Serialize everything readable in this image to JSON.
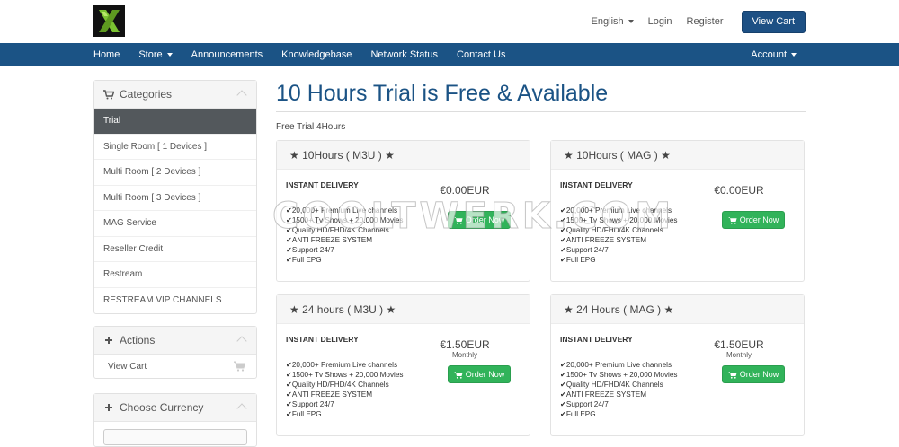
{
  "header": {
    "language_label": "English",
    "login_label": "Login",
    "register_label": "Register",
    "view_cart_label": "View Cart"
  },
  "nav": {
    "items": [
      "Home",
      "Store",
      "Announcements",
      "Knowledgebase",
      "Network Status",
      "Contact Us"
    ],
    "account_label": "Account"
  },
  "sidebar": {
    "categories_title": "Categories",
    "categories": [
      "Trial",
      "Single Room [ 1 Devices ]",
      "Multi Room [ 2 Devices ]",
      "Multi Room [ 3 Devices ]",
      "MAG Service",
      "Reseller Credit",
      "Restream",
      "RESTREAM VIP CHANNELS"
    ],
    "active_index": 0,
    "actions_title": "Actions",
    "view_cart_label": "View Cart",
    "currency_title": "Choose Currency"
  },
  "main": {
    "title": "10 Hours Trial is Free & Available",
    "subtitle": "Free Trial 4Hours",
    "watermark": "COOLTWERK.COM",
    "products": [
      {
        "name": "★ 10Hours ( M3U ) ★",
        "delivery": "INSTANT DELIVERY",
        "price": "€0.00EUR",
        "period": "",
        "order_label": "Order Now",
        "features": [
          "✔20,000+ Premium Live channels",
          "✔1500+ Tv Shows + 20,000 Movies",
          "✔Quality HD/FHD/4K Channels",
          "✔ANTI FREEZE SYSTEM",
          "✔Support 24/7",
          "✔Full EPG"
        ]
      },
      {
        "name": "★ 10Hours ( MAG ) ★",
        "delivery": "INSTANT DELIVERY",
        "price": "€0.00EUR",
        "period": "",
        "order_label": "Order Now",
        "features": [
          "✔20,000+ Premium Live channels",
          "✔1500+ Tv Shows + 20,000 Movies",
          "✔Quality HD/FHD/4K Channels",
          "✔ANTI FREEZE SYSTEM",
          "✔Support 24/7",
          "✔Full EPG"
        ]
      },
      {
        "name": "★ 24 hours ( M3U ) ★",
        "delivery": "INSTANT DELIVERY",
        "price": "€1.50EUR",
        "period": "Monthly",
        "order_label": "Order Now",
        "features": [
          "✔20,000+ Premium Live channels",
          "✔1500+ Tv Shows + 20,000 Movies",
          "✔Quality HD/FHD/4K Channels",
          "✔ANTI FREEZE SYSTEM",
          "✔Support 24/7",
          "✔Full EPG"
        ]
      },
      {
        "name": "★ 24 Hours ( MAG ) ★",
        "delivery": "INSTANT DELIVERY",
        "price": "€1.50EUR",
        "period": "Monthly",
        "order_label": "Order Now",
        "features": [
          "✔20,000+ Premium Live channels",
          "✔1500+ Tv Shows + 20,000 Movies",
          "✔Quality HD/FHD/4K Channels",
          "✔ANTI FREEZE SYSTEM",
          "✔Support 24/7",
          "✔Full EPG"
        ]
      }
    ]
  },
  "colors": {
    "brand_blue": "#1b5385",
    "order_green": "#31b35a",
    "active_category": "#53585c",
    "logo_green": "#7ac231"
  }
}
